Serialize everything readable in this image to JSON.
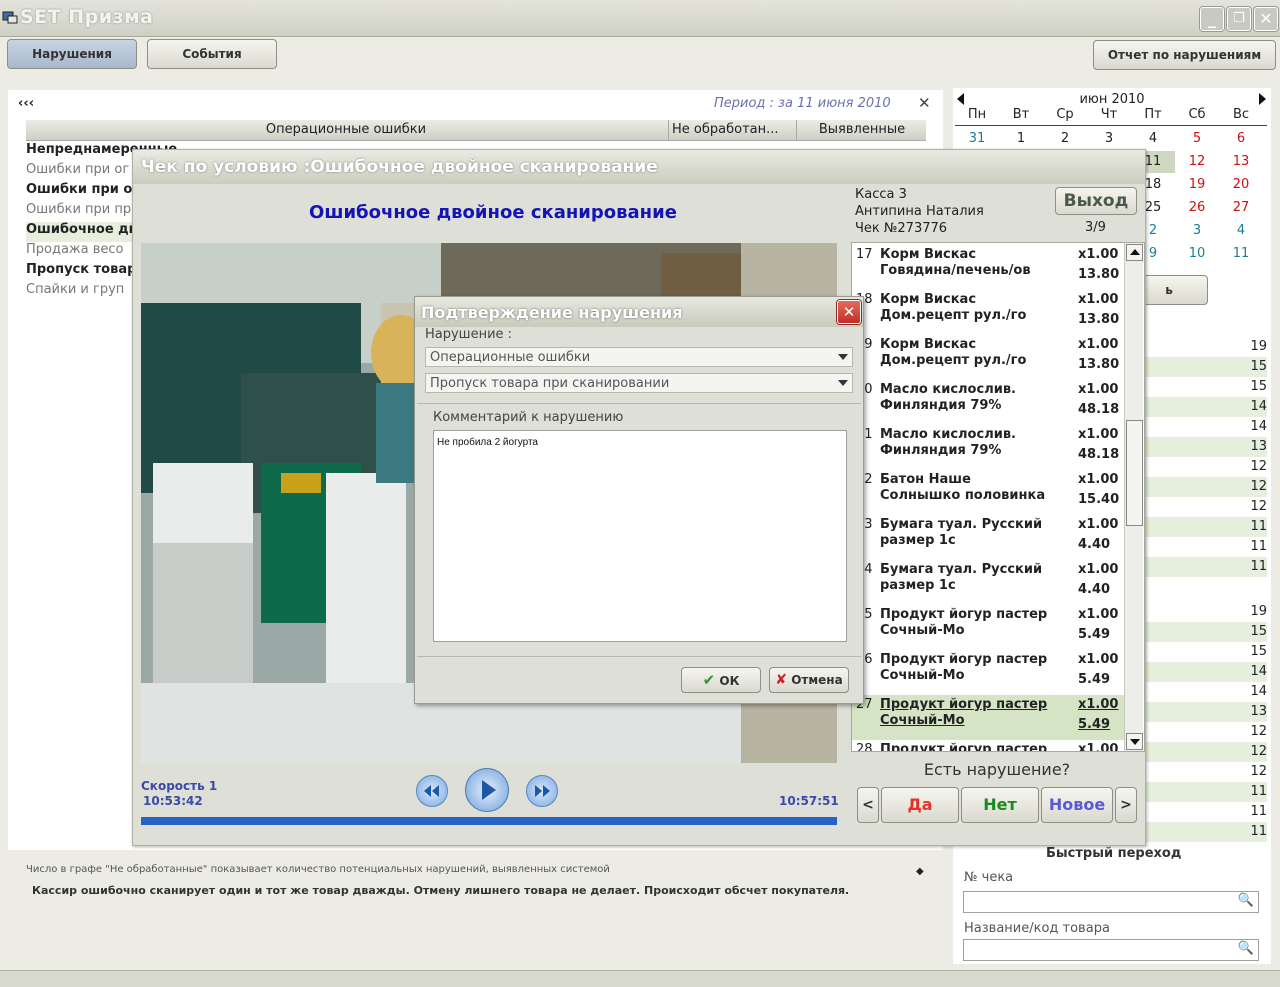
{
  "app": {
    "title": "SET Призма"
  },
  "toolbar": {
    "violations_label": "Нарушения",
    "events_label": "События",
    "report_label": "Отчет по нарушениям"
  },
  "left": {
    "back_label": "‹‹‹",
    "period_label": "Период : за 11 июня 2010",
    "close_glyph": "✕",
    "headers": [
      "Операционные ошибки",
      "Не обработан...",
      "Выявленные"
    ],
    "rows": [
      {
        "label": "Непреднамеренные",
        "bold": true
      },
      {
        "label": "Ошибки при ог",
        "bold": false
      },
      {
        "label": "Ошибки при от",
        "bold": true
      },
      {
        "label": "Ошибки при пр",
        "bold": false
      },
      {
        "label": "Ошибочное дв",
        "bold": true
      },
      {
        "label": "Продажа весо",
        "bold": false
      },
      {
        "label": "Пропуск товар",
        "bold": true
      },
      {
        "label": "Спайки и груп",
        "bold": false
      }
    ]
  },
  "footer": {
    "hint": "Число в графе \"Не обработанные\" показывает количество потенциальных нарушений, выявленных системой",
    "description": "Кассир ошибочно сканирует один и тот же товар дважды. Отмену лишнего товара не делает. Происходит обсчет покупателя."
  },
  "calendar": {
    "month_label": "июн 2010",
    "weekdays": [
      "Пн",
      "Вт",
      "Ср",
      "Чт",
      "Пт",
      "Сб",
      "Вс"
    ],
    "weeks": [
      [
        "31",
        "1",
        "2",
        "3",
        "4",
        "5",
        "6"
      ],
      [
        "",
        "",
        "",
        "",
        "11",
        "12",
        "13"
      ],
      [
        "",
        "",
        "",
        "",
        "18",
        "19",
        "20"
      ],
      [
        "",
        "",
        "",
        "",
        "25",
        "26",
        "27"
      ],
      [
        "",
        "",
        "",
        "",
        "2",
        "3",
        "4"
      ],
      [
        "",
        "",
        "",
        "",
        "9",
        "10",
        "11"
      ]
    ],
    "colors": {
      "weekend": "#cc1111",
      "other_month": "#1a7f8f",
      "normal": "#222222"
    }
  },
  "right_counts_a": [
    "19",
    "15",
    "15",
    "14",
    "14",
    "13",
    "12",
    "12",
    "12",
    "11",
    "11",
    "11"
  ],
  "right_counts_b": [
    "19",
    "15",
    "15",
    "14",
    "14",
    "13",
    "12",
    "12",
    "12",
    "11",
    "11",
    "11"
  ],
  "partial_button": "ь",
  "quick_nav": {
    "title": "Быстрый переход",
    "receipt_label": "№ чека",
    "product_label": "Название/код товара"
  },
  "check_dialog": {
    "title": "Чек по условию :Ошибочное двойное сканирование",
    "heading": "Ошибочное двойное сканирование",
    "register": "Касса  3",
    "cashier": "Антипина Наталия",
    "receipt_no": "Чек №273776",
    "exit_label": "Выход",
    "counter": "3/9",
    "items": [
      {
        "n": "17",
        "name": "Корм Вискас Говядина/печень/ов",
        "qty": "x1.00",
        "price": "13.80",
        "selected": false
      },
      {
        "n": "18",
        "name": "Корм Вискас Дом.рецепт рул./го",
        "qty": "x1.00",
        "price": "13.80",
        "selected": false
      },
      {
        "n": "19",
        "name": "Корм Вискас Дом.рецепт рул./го",
        "qty": "x1.00",
        "price": "13.80",
        "selected": false
      },
      {
        "n": "20",
        "name": "Масло кислослив. Финляндия 79%",
        "qty": "x1.00",
        "price": "48.18",
        "selected": false
      },
      {
        "n": "21",
        "name": "Масло кислослив. Финляндия 79%",
        "qty": "x1.00",
        "price": "48.18",
        "selected": false
      },
      {
        "n": "22",
        "name": "Батон Наше Солнышко половинка",
        "qty": "x1.00",
        "price": "15.40",
        "selected": false
      },
      {
        "n": "23",
        "name": "Бумага туал. Русский размер 1с",
        "qty": "x1.00",
        "price": "4.40",
        "selected": false
      },
      {
        "n": "24",
        "name": "Бумага туал. Русский размер 1с",
        "qty": "x1.00",
        "price": "4.40",
        "selected": false
      },
      {
        "n": "25",
        "name": "Продукт йогур пастер Сочный-Мо",
        "qty": "x1.00",
        "price": "5.49",
        "selected": false
      },
      {
        "n": "26",
        "name": "Продукт йогур пастер Сочный-Мо",
        "qty": "x1.00",
        "price": "5.49",
        "selected": false
      },
      {
        "n": "27",
        "name": "Продукт йогур пастер Сочный-Мо",
        "qty": "x1.00",
        "price": "5.49",
        "selected": true
      },
      {
        "n": "28",
        "name": "Продукт йогур пастер",
        "qty": "x1.00",
        "price": "",
        "selected": false
      }
    ],
    "question": "Есть нарушение?",
    "prev_label": "<",
    "yes_label": "Да",
    "no_label": "Нет",
    "new_label": "Новое",
    "next_label": ">",
    "speed_label": "Скорость 1",
    "time_start": "10:53:42",
    "time_end": "10:57:51",
    "progress_fraction": 1.0
  },
  "confirm_dialog": {
    "title": "Подтверждение нарушения",
    "violation_label": "Нарушение :",
    "category_value": "Операционные ошибки",
    "type_value": "Пропуск товара при сканировании",
    "comment_label": "Комментарий к нарушению",
    "comment_value": "Не пробила 2 йогурта",
    "ok_label": "ОК",
    "cancel_label": "Отмена"
  }
}
